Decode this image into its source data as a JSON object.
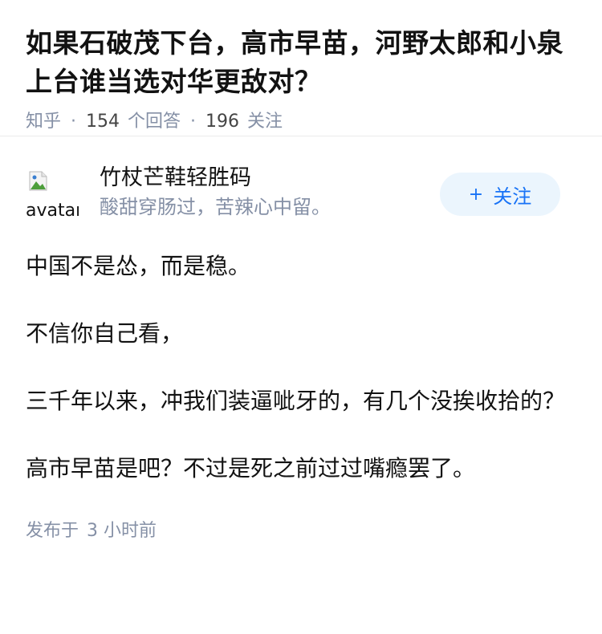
{
  "question": {
    "title": "如果石破茂下台，高市早苗，河野太郎和小泉上台谁当选对华更敌对？",
    "source": "知乎",
    "answer_count": "154",
    "answer_label": "个回答",
    "follower_count": "196",
    "follower_label": "关注"
  },
  "author": {
    "avatar_alt": "avatar",
    "name": "竹杖芒鞋轻胜码",
    "bio": "酸甜穿肠过，苦辣心中留。",
    "follow_label": "关注",
    "follow_icon": "plus-icon"
  },
  "answer": {
    "paragraphs": [
      "中国不是怂，而是稳。",
      "不信你自己看，",
      "三千年以来，冲我们装逼呲牙的，有几个没挨收拾的？",
      "高市早苗是吧？不过是死之前过过嘴瘾罢了。"
    ],
    "published_label": "发布于",
    "published_time": "3 小时前"
  },
  "colors": {
    "meta_gray": "#8590a6",
    "follow_blue": "#1772f6",
    "follow_bg": "#ebf5fd"
  }
}
